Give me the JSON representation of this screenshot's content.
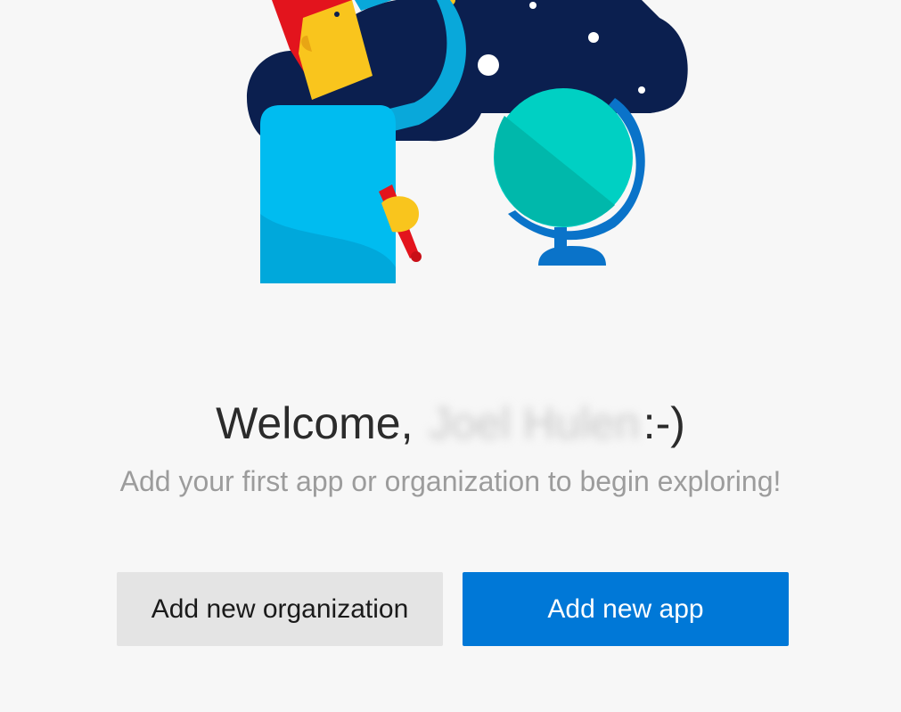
{
  "welcome": {
    "greeting": "Welcome,",
    "name": "Joel Hulen",
    "emoticon": ":-)"
  },
  "subtitle": "Add your first app or organization to begin exploring!",
  "actions": {
    "add_organization_label": "Add new organization",
    "add_app_label": "Add new app"
  },
  "colors": {
    "primary_button": "#0078d7",
    "secondary_button": "#e4e4e4",
    "background": "#f7f7f7",
    "illustration_navy": "#0b1f4f",
    "illustration_cyan": "#00bcf0",
    "illustration_teal": "#00d0c3",
    "illustration_blue": "#0a73c9",
    "illustration_yellow": "#f9c51d",
    "illustration_red": "#e3141d"
  },
  "illustration": {
    "icon_name": "welcome-hero-illustration"
  }
}
